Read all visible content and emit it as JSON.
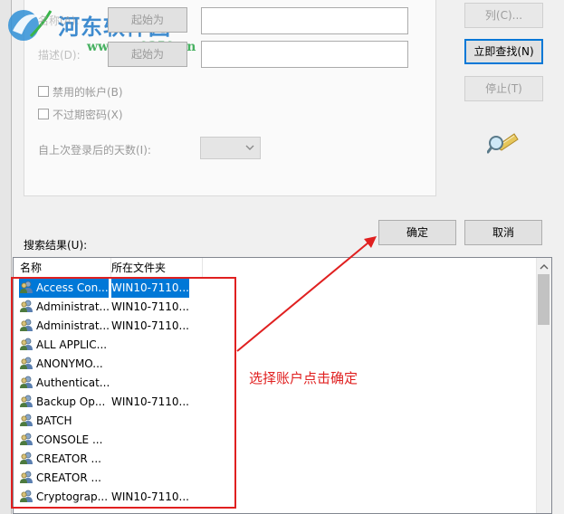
{
  "watermark": {
    "title": "河东软件园",
    "url": "www.pc0359.cn"
  },
  "search_form": {
    "name_label": "名称(A):",
    "desc_label": "描述(D):",
    "name_mode": "起始为",
    "desc_mode": "起始为",
    "disabled_accounts": "禁用的帐户(B)",
    "non_expiring_pwd": "不过期密码(X)",
    "days_since_logon": "自上次登录后的天数(I):"
  },
  "buttons": {
    "columns": "列(C)...",
    "find_now": "立即查找(N)",
    "stop": "停止(T)",
    "ok": "确定",
    "cancel": "取消"
  },
  "results_label": "搜索结果(U):",
  "columns": [
    "名称",
    "所在文件夹"
  ],
  "rows": [
    {
      "name": "Access Con...",
      "folder": "WIN10-7110..."
    },
    {
      "name": "Administrat...",
      "folder": "WIN10-7110..."
    },
    {
      "name": "Administrat...",
      "folder": "WIN10-7110..."
    },
    {
      "name": "ALL APPLIC...",
      "folder": ""
    },
    {
      "name": "ANONYMO...",
      "folder": ""
    },
    {
      "name": "Authenticat...",
      "folder": ""
    },
    {
      "name": "Backup Op...",
      "folder": "WIN10-7110..."
    },
    {
      "name": "BATCH",
      "folder": ""
    },
    {
      "name": "CONSOLE ...",
      "folder": ""
    },
    {
      "name": "CREATOR ...",
      "folder": ""
    },
    {
      "name": "CREATOR ...",
      "folder": ""
    },
    {
      "name": "Cryptograp...",
      "folder": "WIN10-7110..."
    }
  ],
  "annotation": {
    "text": "选择账户点击确定",
    "color": "#e02020"
  },
  "colors": {
    "selection": "#0078d7",
    "focus_border": "#0078d7",
    "annotation": "#e02020"
  }
}
